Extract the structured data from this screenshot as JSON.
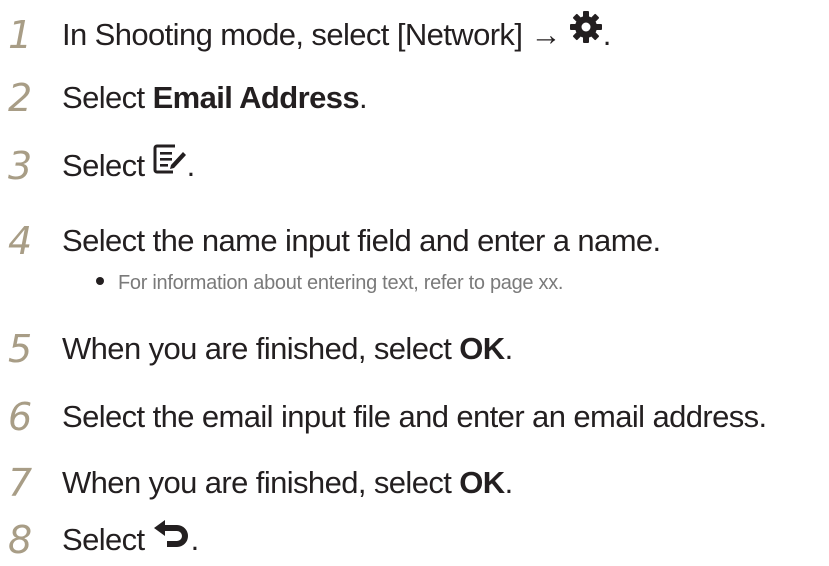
{
  "steps": [
    {
      "num": "1",
      "pre": "In Shooting mode, select [Network] → ",
      "icon": "gear-icon",
      "post": "."
    },
    {
      "num": "2",
      "pre": "Select ",
      "bold": "Email Address",
      "post": "."
    },
    {
      "num": "3",
      "pre": "Select ",
      "icon": "edit-icon",
      "post": "."
    },
    {
      "num": "4",
      "pre": "Select the name input field and enter a name."
    },
    {
      "bullet": "For information about entering text, refer to page xx."
    },
    {
      "num": "5",
      "pre": "When you are finished, select ",
      "bold": "OK",
      "post": "."
    },
    {
      "num": "6",
      "pre": "Select the email input file and enter an email address."
    },
    {
      "num": "7",
      "pre": "When you are finished, select ",
      "bold": "OK",
      "post": "."
    },
    {
      "num": "8",
      "pre": "Select ",
      "icon": "back-arrow-icon",
      "post": "."
    }
  ]
}
